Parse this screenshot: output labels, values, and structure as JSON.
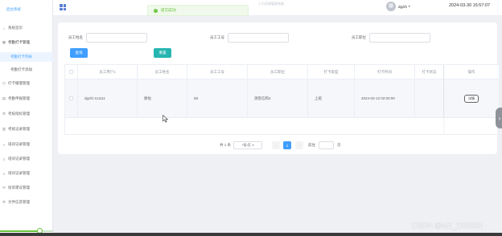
{
  "sidebar": {
    "brand": "后台系统",
    "items": [
      {
        "label": "系统首页",
        "icon": "home-icon",
        "glyph": "⌂"
      },
      {
        "label": "考勤打卡管理",
        "icon": "grid-icon",
        "glyph": "▦"
      },
      {
        "label": "考勤打卡列表",
        "icon": "",
        "glyph": ""
      },
      {
        "label": "考勤打卡添加",
        "icon": "",
        "glyph": ""
      },
      {
        "label": "打卡缓慢管理",
        "icon": "clock-icon",
        "glyph": "◷"
      },
      {
        "label": "考勤申报管理",
        "icon": "document-icon",
        "glyph": "▤"
      },
      {
        "label": "考核指标管理",
        "icon": "gear-icon",
        "glyph": "⚙"
      },
      {
        "label": "考核记录管理",
        "icon": "chart-icon",
        "glyph": "▥"
      },
      {
        "label": "培训记录管理",
        "icon": "search-icon",
        "glyph": "⌕"
      },
      {
        "label": "培训记录管理",
        "icon": "list-icon",
        "glyph": "≡"
      },
      {
        "label": "培训记录管理",
        "icon": "list-icon",
        "glyph": "≡"
      },
      {
        "label": "投诉建议管理",
        "icon": "message-icon",
        "glyph": "✉"
      },
      {
        "label": "文件信息管理",
        "icon": "gear-icon",
        "glyph": "⚙"
      }
    ],
    "progress_fraction": 0.75
  },
  "header": {
    "title": "人力资源管理系统",
    "toast": "提交成功!",
    "username": "dgzth",
    "datetime": "2024-03-30 15:57:07"
  },
  "search": {
    "fields": [
      {
        "label": "员工姓名",
        "value": ""
      },
      {
        "label": "员工工号",
        "value": ""
      },
      {
        "label": "员工职位",
        "value": ""
      }
    ],
    "query_button": "查询",
    "reset_button": "重置"
  },
  "table": {
    "columns": [
      "员工用户1",
      "员工姓名",
      "员工工号",
      "员工职位",
      "打卡类型",
      "打卡时间",
      "打卡状态",
      "操作"
    ],
    "rows": [
      {
        "cells": [
          "dgzth-111111",
          "廖佑",
          "68",
          "测签信和2",
          "上班",
          "2024-03-13 02:00:00",
          ""
        ],
        "action": "详情"
      }
    ]
  },
  "pagination": {
    "total_text": "共 1 条",
    "page_size": "7条/页",
    "prev": "‹",
    "current_page": "1",
    "next": "›",
    "goto_label": "前往",
    "page_suffix": "页"
  },
  "watermark": "CSDN @MZ_ZXD001",
  "colors": {
    "primary": "#409eff",
    "reset": "#26b5b0",
    "success": "#67c23a"
  }
}
